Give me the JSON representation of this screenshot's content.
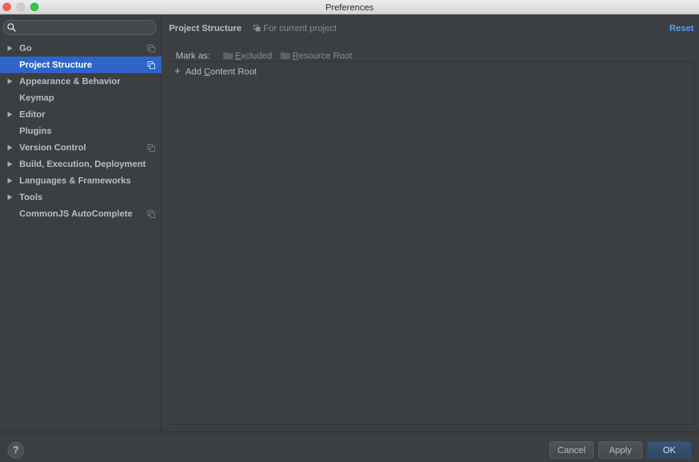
{
  "window": {
    "title": "Preferences"
  },
  "search": {
    "value": "",
    "placeholder": ""
  },
  "sidebar": {
    "items": [
      {
        "label": "Go",
        "expandable": true,
        "copy_icon": true,
        "selected": false
      },
      {
        "label": "Project Structure",
        "expandable": false,
        "copy_icon": true,
        "selected": true
      },
      {
        "label": "Appearance & Behavior",
        "expandable": true,
        "copy_icon": false,
        "selected": false
      },
      {
        "label": "Keymap",
        "expandable": false,
        "copy_icon": false,
        "selected": false
      },
      {
        "label": "Editor",
        "expandable": true,
        "copy_icon": false,
        "selected": false
      },
      {
        "label": "Plugins",
        "expandable": false,
        "copy_icon": false,
        "selected": false
      },
      {
        "label": "Version Control",
        "expandable": true,
        "copy_icon": true,
        "selected": false
      },
      {
        "label": "Build, Execution, Deployment",
        "expandable": true,
        "copy_icon": false,
        "selected": false
      },
      {
        "label": "Languages & Frameworks",
        "expandable": true,
        "copy_icon": false,
        "selected": false
      },
      {
        "label": "Tools",
        "expandable": true,
        "copy_icon": false,
        "selected": false
      },
      {
        "label": "CommonJS AutoComplete",
        "expandable": false,
        "copy_icon": true,
        "selected": false
      }
    ]
  },
  "main": {
    "title": "Project Structure",
    "scope_text": "For current project",
    "reset_label": "Reset",
    "mark_as_label": "Mark as:",
    "excluded": {
      "mnemonic": "E",
      "rest": "xcluded"
    },
    "resource_root": {
      "mnemonic": "R",
      "rest": "esource Root"
    },
    "add_content_root": {
      "before": "Add ",
      "mnemonic": "C",
      "after": "ontent Root"
    }
  },
  "footer": {
    "help_label": "?",
    "cancel_label": "Cancel",
    "apply_label": "Apply",
    "ok_label": "OK"
  },
  "colors": {
    "selection": "#2f65ca",
    "link": "#589df6",
    "background": "#3c3f41"
  }
}
